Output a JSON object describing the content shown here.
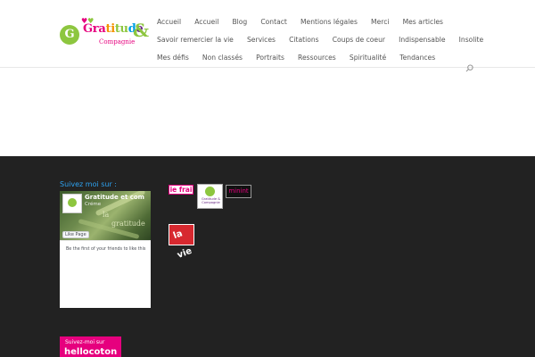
{
  "logo": {
    "mark": "G",
    "word_parts": [
      "Gra",
      "ti",
      "tu",
      "d",
      "e"
    ],
    "ampersand": "&",
    "sub": "Compagnie"
  },
  "nav": {
    "rows": [
      [
        "Accueil",
        "Accueil",
        "Blog",
        "Contact",
        "Mentions légales",
        "Merci",
        "Mes articles"
      ],
      [
        "Savoir remercier la vie",
        "Services",
        "Citations",
        "Coups de coeur",
        "Indispensable",
        "Insolite"
      ],
      [
        "Mes défis",
        "Non classés",
        "Portraits",
        "Ressources",
        "Spiritualité",
        "Tendances"
      ]
    ],
    "search_icon": "search-icon"
  },
  "footer": {
    "follow_label": "Suivez moi sur :",
    "facebook": {
      "page_title": "Gratitude et com",
      "likes": "Créme",
      "like_button": "Like Page",
      "friends_text": "Be the first of your friends to like this",
      "overlay_words": [
        "la",
        "gratitude"
      ]
    },
    "badges": {
      "frai": "ie frai",
      "ga_text": "Gratitude & Compagnie",
      "minin": "minint",
      "lavie": "la vie"
    },
    "hellocoton": {
      "small": "Suivez-moi sur",
      "big": "hellocoton"
    }
  },
  "colors": {
    "accent": "#2ea3f2",
    "footer_bg": "#222222",
    "brand_pink": "#e6007e",
    "brand_green": "#8dc63f"
  }
}
